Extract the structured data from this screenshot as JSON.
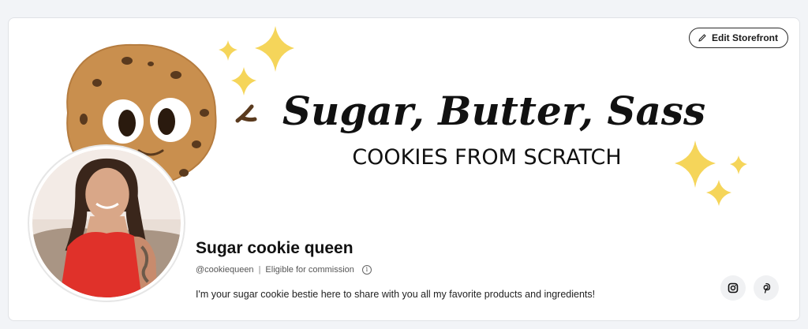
{
  "header": {
    "edit_label": "Edit Storefront"
  },
  "banner": {
    "title": "Sugar, Butter, Sass",
    "subtitle": "COOKIES FROM SCRATCH",
    "accent_color": "#f5d55a",
    "cookie_color": "#c98f4e"
  },
  "profile": {
    "name": "Sugar cookie queen",
    "handle": "@cookiequeen",
    "separator": "|",
    "eligibility": "Eligible for commission",
    "bio": "I'm your sugar cookie bestie here to share with you all my favorite products and ingredients!"
  },
  "social": {
    "instagram_icon": "instagram-icon",
    "pinterest_icon": "pinterest-icon"
  }
}
